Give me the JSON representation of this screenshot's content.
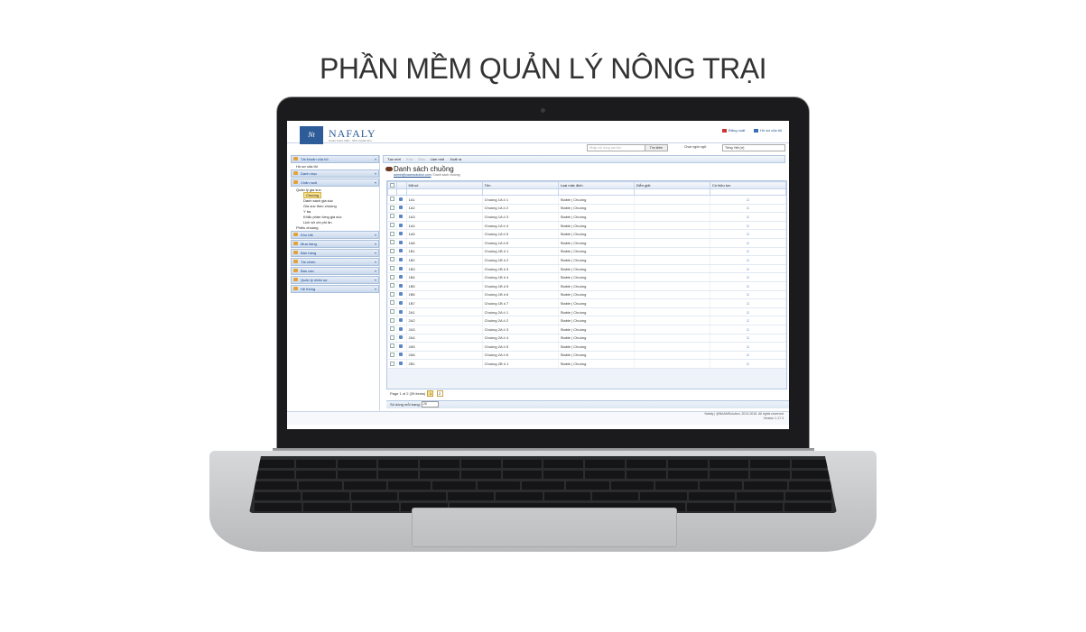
{
  "headline": "PHẦN MỀM QUẢN LÝ NÔNG TRẠI",
  "app": {
    "logo_mark": "Nt",
    "logo_text": "NAFALY",
    "tagline": "Smart & EU-VIET - NFS trustful firm",
    "top_links": {
      "logout": "Đăng xuất",
      "profile": "Hồ sơ của tôi"
    },
    "search": {
      "placeholder": "Nhập nội dung cần tìm",
      "button": "Tìm kiếm"
    },
    "language": {
      "label": "Chọn ngôn ngữ",
      "selected": "Tiếng Việt (vi)"
    }
  },
  "sidebar": {
    "account_section": "Tài khoản của tôi",
    "account_item": "Hồ sơ của tôi",
    "catalog_section": "Danh mục",
    "farming_section": "Chăn nuôi",
    "tree": {
      "herd_mgmt": "Quản lý gia súc",
      "barn": "Chuồng",
      "livestock_list": "Danh sách gia súc",
      "by_barn": "Gia súc theo chuồng",
      "vet": "Y bạ",
      "ration": "Khẩu phần từng gia súc",
      "feed_cost": "Lịch sử chi phí ăn",
      "feed_slip": "Phiếu chuồng"
    },
    "sections": [
      "Kho bãi",
      "Mua hàng",
      "Bán hàng",
      "Tài chính",
      "Báo cáo",
      "Quản lý nhân sự",
      "Hệ thống"
    ]
  },
  "toolbar": {
    "new": "Tạo mới",
    "delete": "Xóa",
    "edit": "Sửa",
    "refresh": "Làm mới",
    "export": "Xuất ra"
  },
  "page": {
    "title": "Danh sách chuồng",
    "breadcrumb_user": "admin@naamsolution.com",
    "breadcrumb_page": "Danh sách chuồng"
  },
  "grid": {
    "columns": [
      "Mã số",
      "Tên",
      "Loại mặc định",
      "Diễn giải",
      "Có hiệu lực"
    ],
    "rows": [
      [
        "1A1",
        "Chuồng 1A ô 1",
        "Stable | Chuồng"
      ],
      [
        "1A2",
        "Chuồng 1A ô 2",
        "Stable | Chuồng"
      ],
      [
        "1A3",
        "Chuồng 1A ô 3",
        "Stable | Chuồng"
      ],
      [
        "1A4",
        "Chuồng 1A ô 4",
        "Stable | Chuồng"
      ],
      [
        "1A5",
        "Chuồng 1A ô 5",
        "Stable | Chuồng"
      ],
      [
        "1A6",
        "Chuồng 1A ô 6",
        "Stable | Chuồng"
      ],
      [
        "1B1",
        "Chuồng 1B ô 1",
        "Stable | Chuồng"
      ],
      [
        "1B2",
        "Chuồng 1B ô 2",
        "Stable | Chuồng"
      ],
      [
        "1B3",
        "Chuồng 1B ô 3",
        "Stable | Chuồng"
      ],
      [
        "1B4",
        "Chuồng 1B ô 4",
        "Stable | Chuồng"
      ],
      [
        "1B5",
        "Chuồng 1B ô 5",
        "Stable | Chuồng"
      ],
      [
        "1B6",
        "Chuồng 1B ô 6",
        "Stable | Chuồng"
      ],
      [
        "1B7",
        "Chuồng 1B ô 7",
        "Stable | Chuồng"
      ],
      [
        "2A1",
        "Chuồng 2A ô 1",
        "Stable | Chuồng"
      ],
      [
        "2A2",
        "Chuồng 2A ô 2",
        "Stable | Chuồng"
      ],
      [
        "2A3",
        "Chuồng 2A ô 3",
        "Stable | Chuồng"
      ],
      [
        "2A4",
        "Chuồng 2A ô 4",
        "Stable | Chuồng"
      ],
      [
        "2A5",
        "Chuồng 2A ô 5",
        "Stable | Chuồng"
      ],
      [
        "2A6",
        "Chuồng 2A ô 6",
        "Stable | Chuồng"
      ],
      [
        "2B1",
        "Chuồng 2B ô 1",
        "Stable | Chuồng"
      ]
    ]
  },
  "pager": {
    "info": "Page 1 of 2 (39 items)",
    "pages": [
      "1",
      "2"
    ],
    "size_label": "Số dòng mỗi trang:",
    "size_value": "20"
  },
  "footer": {
    "copyright": "Nafaly | @NAAMSolution, 2013-2016. All rights reserved",
    "version": "Version 1.17.3"
  },
  "colors": {
    "brand": "#2d5c98",
    "header_gradient": "#c9d8ec",
    "selected": "#f8e08a"
  }
}
